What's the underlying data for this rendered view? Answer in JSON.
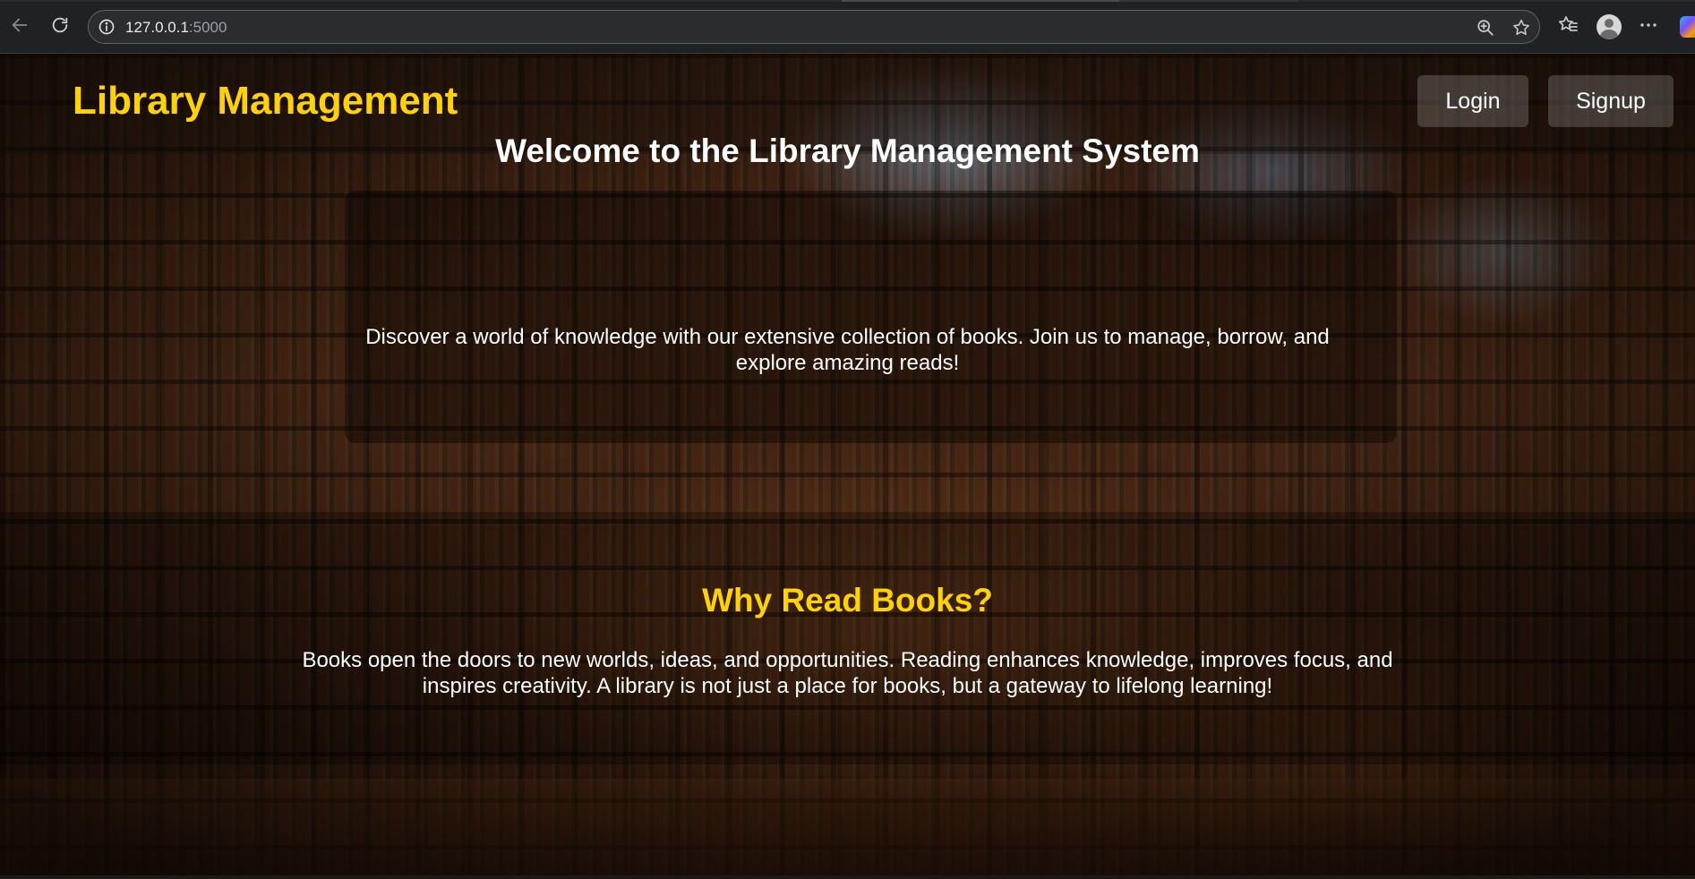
{
  "browser": {
    "url_host": "127.0.0.1",
    "url_port": ":5000",
    "icons": {
      "back": "back-arrow-icon",
      "reload": "reload-icon",
      "info": "info-icon",
      "zoom": "zoom-in-icon",
      "bookmark": "star-icon",
      "favorites": "favorites-icon",
      "profile": "profile-avatar-icon",
      "menu": "more-menu-icon"
    }
  },
  "header": {
    "brand": "Library Management",
    "login_label": "Login",
    "signup_label": "Signup"
  },
  "hero": {
    "title": "Welcome to the Library Management System",
    "text": "Discover a world of knowledge with our extensive collection of books. Join us to manage, borrow, and explore amazing reads!"
  },
  "why": {
    "title": "Why Read Books?",
    "text": "Books open the doors to new worlds, ideas, and opportunities. Reading enhances knowledge, improves focus, and inspires creativity. A library is not just a place for books, but a gateway to lifelong learning!"
  },
  "colors": {
    "brand": "#ffd200",
    "text": "#ffffff",
    "chrome_bg": "#202124"
  }
}
